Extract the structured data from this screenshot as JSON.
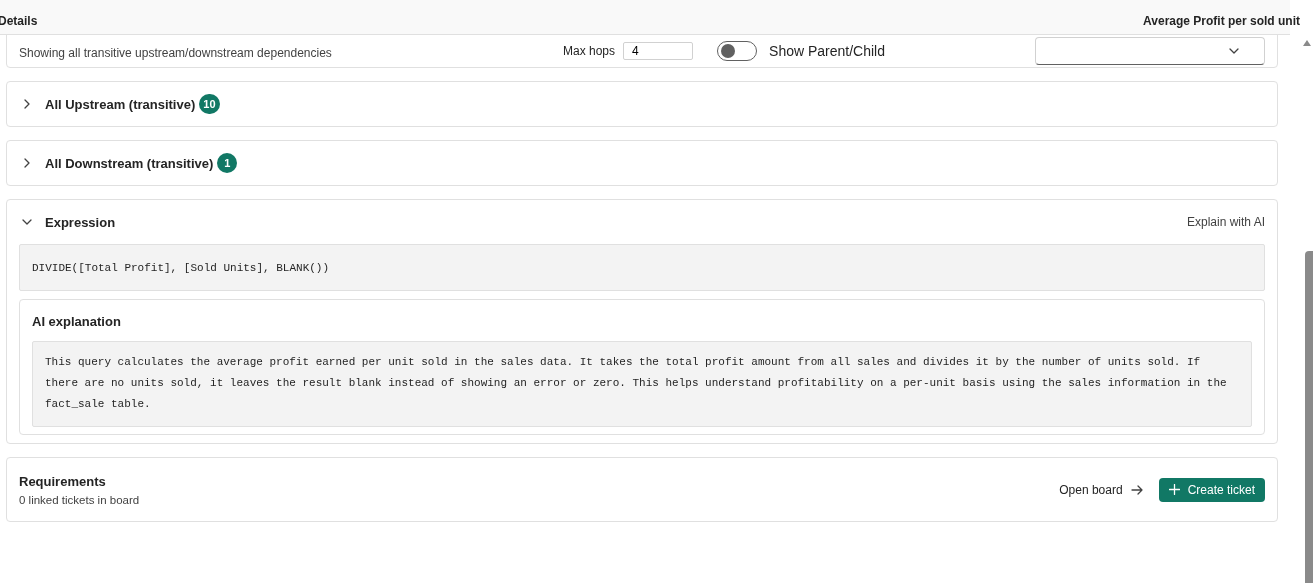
{
  "header": {
    "title": "Details",
    "entity": "Average Profit per sold unit"
  },
  "scope": {
    "subtitle": "Showing all transitive upstream/downstream dependencies",
    "max_hops": {
      "label": "Max hops",
      "value": "4"
    },
    "toggle": {
      "label": "Show Parent/Child",
      "on": false
    }
  },
  "sections": [
    {
      "kind": "list",
      "title": "All Upstream (transitive)",
      "count": "10",
      "expanded": false
    },
    {
      "kind": "list",
      "title": "All Downstream (transitive)",
      "count": "1",
      "expanded": false
    },
    {
      "kind": "expression",
      "title": "Expression",
      "expanded": true,
      "action": "Explain with AI",
      "code": "DIVIDE([Total Profit], [Sold Units], BLANK())",
      "ai": {
        "title": "AI explanation",
        "text": "This query calculates the average profit earned per unit sold in the sales data. It takes the total profit amount from all sales and divides it by the number of units sold. If there are no units sold, it leaves the result blank instead of showing an error or zero. This helps understand profitability on a per-unit basis using the sales information in the fact_sale table."
      }
    }
  ],
  "requirements": {
    "title": "Requirements",
    "subtitle": "0 linked tickets in board",
    "link": "Open board",
    "button": "Create ticket"
  }
}
